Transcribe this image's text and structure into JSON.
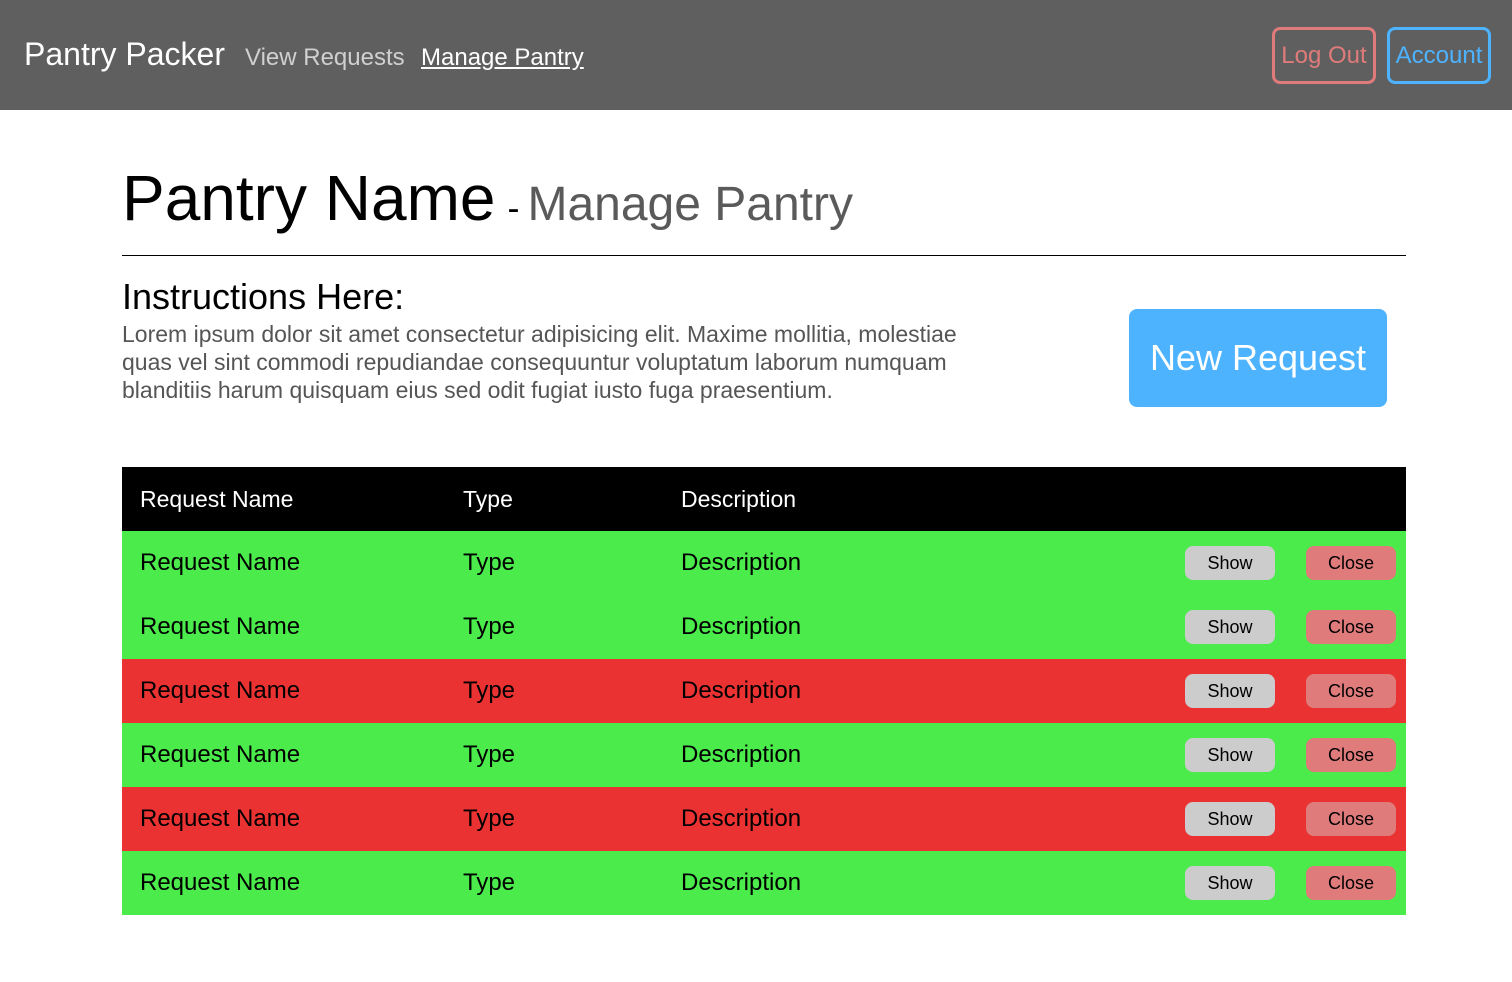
{
  "nav": {
    "brand": "Pantry Packer",
    "links": [
      {
        "label": "View Requests",
        "active": false
      },
      {
        "label": "Manage Pantry",
        "active": true
      }
    ],
    "logout_label": "Log Out",
    "account_label": "Account"
  },
  "page": {
    "title": "Pantry Name",
    "dash": "-",
    "subtitle": "Manage Pantry",
    "instructions_heading": "Instructions Here:",
    "instructions_body": "Lorem ipsum dolor sit amet consectetur adipisicing elit. Maxime mollitia, molestiae quas vel sint commodi repudiandae consequuntur voluptatum laborum numquam blanditiis harum quisquam eius sed odit fugiat iusto fuga praesentium.",
    "new_request_label": "New Request"
  },
  "table": {
    "headers": [
      "Request Name",
      "Type",
      "Description"
    ],
    "rows": [
      {
        "name": "Request Name",
        "type": "Type",
        "description": "Description",
        "status": "green",
        "show_label": "Show",
        "close_label": "Close"
      },
      {
        "name": "Request Name",
        "type": "Type",
        "description": "Description",
        "status": "green",
        "show_label": "Show",
        "close_label": "Close"
      },
      {
        "name": "Request Name",
        "type": "Type",
        "description": "Description",
        "status": "red",
        "show_label": "Show",
        "close_label": "Close"
      },
      {
        "name": "Request Name",
        "type": "Type",
        "description": "Description",
        "status": "green",
        "show_label": "Show",
        "close_label": "Close"
      },
      {
        "name": "Request Name",
        "type": "Type",
        "description": "Description",
        "status": "red",
        "show_label": "Show",
        "close_label": "Close"
      },
      {
        "name": "Request Name",
        "type": "Type",
        "description": "Description",
        "status": "green",
        "show_label": "Show",
        "close_label": "Close"
      }
    ]
  },
  "colors": {
    "navbar": "#5f5f5f",
    "row_green": "#4aeb4a",
    "row_red": "#ea3232",
    "accent_blue": "#4db3ff",
    "accent_red": "#e07b7b",
    "show_button": "#cccccc"
  }
}
